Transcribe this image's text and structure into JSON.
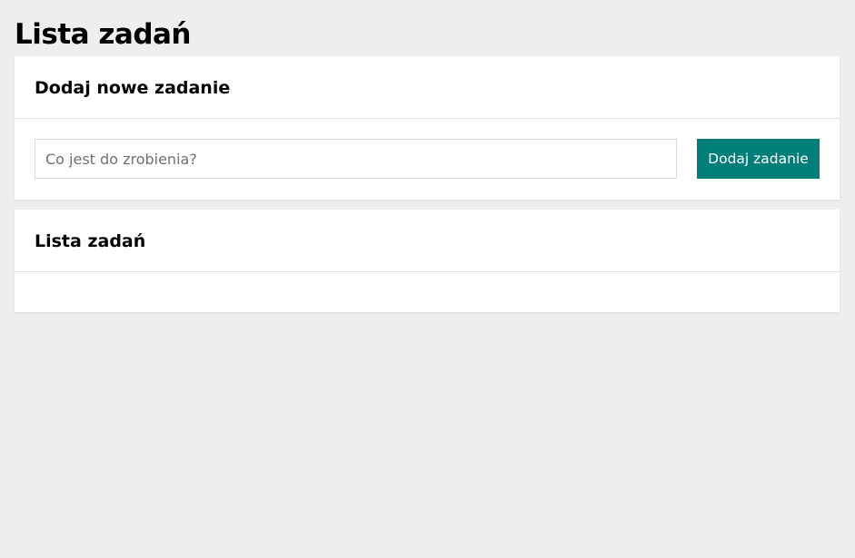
{
  "page": {
    "title": "Lista zadań"
  },
  "add_task": {
    "title": "Dodaj nowe zadanie",
    "input": {
      "placeholder": "Co jest do zrobienia?",
      "value": ""
    },
    "button_label": "Dodaj zadanie"
  },
  "task_list": {
    "title": "Lista zadań",
    "items": []
  },
  "colors": {
    "background": "#eeeeee",
    "card": "#ffffff",
    "accent": "#007f7a"
  }
}
